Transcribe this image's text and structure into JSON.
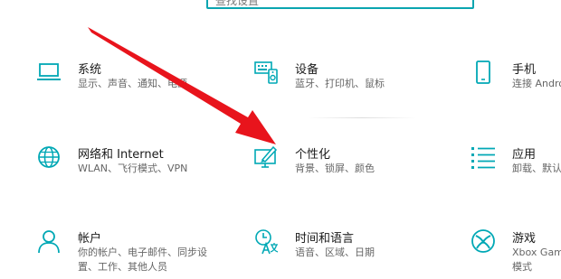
{
  "search": {
    "placeholder": "查找设置"
  },
  "colors": {
    "accent": "#00a8b5",
    "arrow": "#e8141c"
  },
  "tiles": [
    {
      "name": "系统",
      "desc": [
        "显示、声音、通知、电源"
      ],
      "icon": "laptop-icon"
    },
    {
      "name": "设备",
      "desc": [
        "蓝牙、打印机、鼠标"
      ],
      "icon": "keyboard-speaker-icon"
    },
    {
      "name": "手机",
      "desc": [
        "连接 Andro"
      ],
      "icon": "phone-icon"
    },
    {
      "name": "网络和 Internet",
      "desc": [
        "WLAN、飞行模式、VPN"
      ],
      "icon": "globe-icon"
    },
    {
      "name": "个性化",
      "desc": [
        "背景、锁屏、颜色"
      ],
      "icon": "personalize-icon"
    },
    {
      "name": "应用",
      "desc": [
        "卸载、默认"
      ],
      "icon": "apps-list-icon"
    },
    {
      "name": "帐户",
      "desc": [
        "你的帐户、电子邮件、同步设",
        "置、工作、其他人员"
      ],
      "icon": "user-icon"
    },
    {
      "name": "时间和语言",
      "desc": [
        "语音、区域、日期"
      ],
      "icon": "time-language-icon"
    },
    {
      "name": "游戏",
      "desc": [
        "Xbox Game",
        "模式"
      ],
      "icon": "xbox-icon"
    }
  ]
}
